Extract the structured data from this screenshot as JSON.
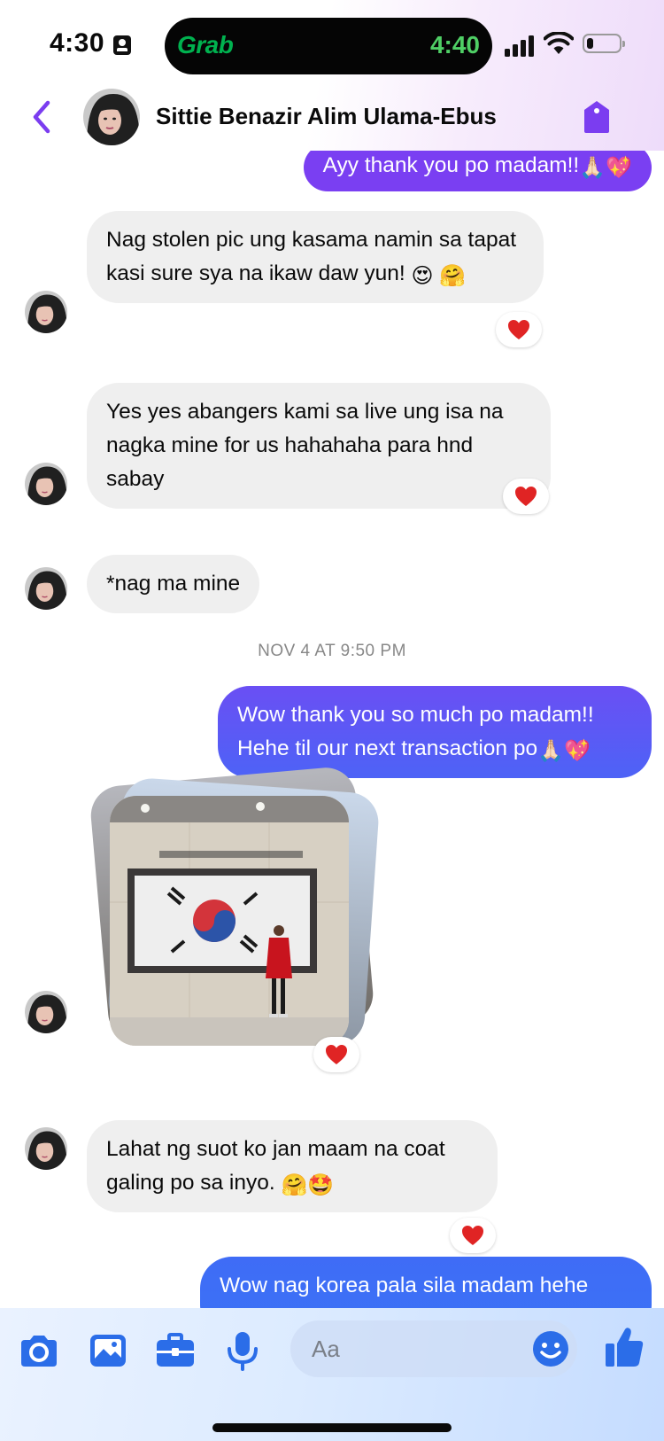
{
  "status_bar": {
    "time": "4:30",
    "island_app": "Grab",
    "island_time": "4:40",
    "battery_level": 0.2
  },
  "header": {
    "contact_name": "Sittie Benazir Alim Ulama-Ebus"
  },
  "messages": [
    {
      "from": "me",
      "text": "Ayy thank you po madam!!",
      "emoji": "🙏🏻💖"
    },
    {
      "from": "them",
      "text": "Nag stolen pic ung kasama namin sa tapat kasi sure sya na ikaw daw yun!",
      "emoji": "😍 🤗",
      "reaction": "❤️"
    },
    {
      "from": "them",
      "text": "Yes yes abangers kami sa live ung isa na nagka mine for us hahahaha para hnd sabay",
      "reaction": "❤️"
    },
    {
      "from": "them",
      "text": "*nag ma mine"
    },
    {
      "type": "timestamp",
      "text": "NOV 4 AT 9:50 PM"
    },
    {
      "from": "me",
      "text": "Wow thank you so much po madam!! Hehe til our next transaction po",
      "emoji": "🙏🏻💖"
    },
    {
      "from": "them",
      "type": "photo_stack",
      "photo_count": 3,
      "reaction": "❤️"
    },
    {
      "from": "them",
      "text": "Lahat ng suot ko jan maam na coat galing po sa inyo.",
      "emoji": "🤗🤩",
      "reaction": "❤️"
    },
    {
      "from": "me",
      "text": "Wow nag korea pala sila madam hehe"
    }
  ],
  "composer": {
    "placeholder": "Aa",
    "tools": [
      "camera-icon",
      "gallery-icon",
      "briefcase-icon",
      "microphone-icon"
    ]
  },
  "colors": {
    "accent_purple": "#7b3df0",
    "outgoing_top": "#7a3ff2",
    "outgoing_bottom": "#3f6ef8",
    "incoming_bubble": "#efefef",
    "reaction_heart": "#e02424",
    "icon_blue": "#2b6de8"
  }
}
